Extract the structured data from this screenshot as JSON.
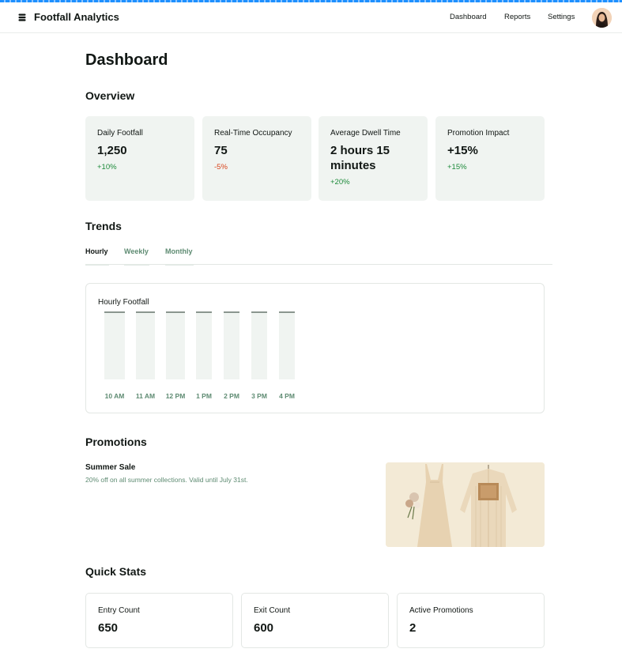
{
  "app": {
    "title": "Footfall Analytics"
  },
  "nav": {
    "items": [
      "Dashboard",
      "Reports",
      "Settings"
    ]
  },
  "page": {
    "title": "Dashboard"
  },
  "overview": {
    "title": "Overview",
    "cards": [
      {
        "label": "Daily Footfall",
        "value": "1,250",
        "delta": "+10%"
      },
      {
        "label": "Real-Time Occupancy",
        "value": "75",
        "delta": "-5%"
      },
      {
        "label": "Average Dwell Time",
        "value": "2 hours 15 minutes",
        "delta": "+20%"
      },
      {
        "label": "Promotion Impact",
        "value": "+15%",
        "delta": "+15%"
      }
    ]
  },
  "trends": {
    "title": "Trends",
    "tabs": [
      "Hourly",
      "Weekly",
      "Monthly"
    ],
    "active_tab": "Hourly",
    "chart_title": "Hourly Footfall"
  },
  "chart_data": {
    "type": "bar",
    "title": "Hourly Footfall",
    "categories": [
      "10 AM",
      "11 AM",
      "12 PM",
      "1 PM",
      "2 PM",
      "3 PM",
      "4 PM"
    ],
    "values": [
      1,
      1,
      1,
      1,
      1,
      1,
      1
    ],
    "xlabel": "",
    "ylabel": "",
    "grid": false
  },
  "promotions": {
    "title": "Promotions",
    "items": [
      {
        "name": "Summer Sale",
        "description": "20% off on all summer collections. Valid until July 31st."
      }
    ]
  },
  "quick_stats": {
    "title": "Quick Stats",
    "cards": [
      {
        "label": "Entry Count",
        "value": "650"
      },
      {
        "label": "Exit Count",
        "value": "600"
      },
      {
        "label": "Active Promotions",
        "value": "2"
      }
    ]
  },
  "colors": {
    "accent": "#5e8b72",
    "card_bg": "#f0f4f1",
    "positive": "#1d8a3a",
    "negative": "#d9441c",
    "bar_fill": "#f0f4f1",
    "bar_top": "#4a5a52"
  },
  "icons": {
    "logo": "stack-icon",
    "avatar": "user-avatar"
  }
}
